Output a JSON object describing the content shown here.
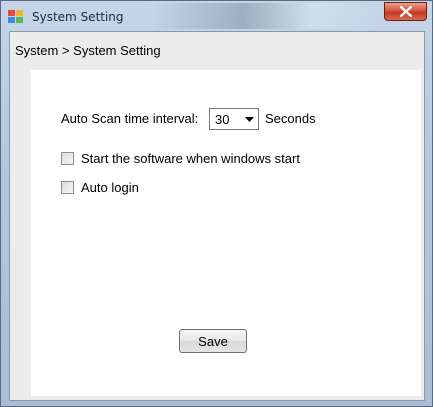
{
  "window": {
    "title": "System Setting",
    "icons": {
      "app": "app-icon",
      "close": "close-icon"
    }
  },
  "breadcrumb": "System > System Setting",
  "settings": {
    "scan_interval_label": "Auto Scan time interval:",
    "scan_interval_value": "30",
    "scan_interval_unit": "Seconds",
    "start_with_windows": {
      "label": "Start the software when windows start",
      "checked": false
    },
    "auto_login": {
      "label": "Auto login",
      "checked": false
    }
  },
  "actions": {
    "save_label": "Save"
  },
  "colors": {
    "close_button": "#c9432a",
    "panel_bg": "#ffffff",
    "client_bg": "#ececec"
  }
}
